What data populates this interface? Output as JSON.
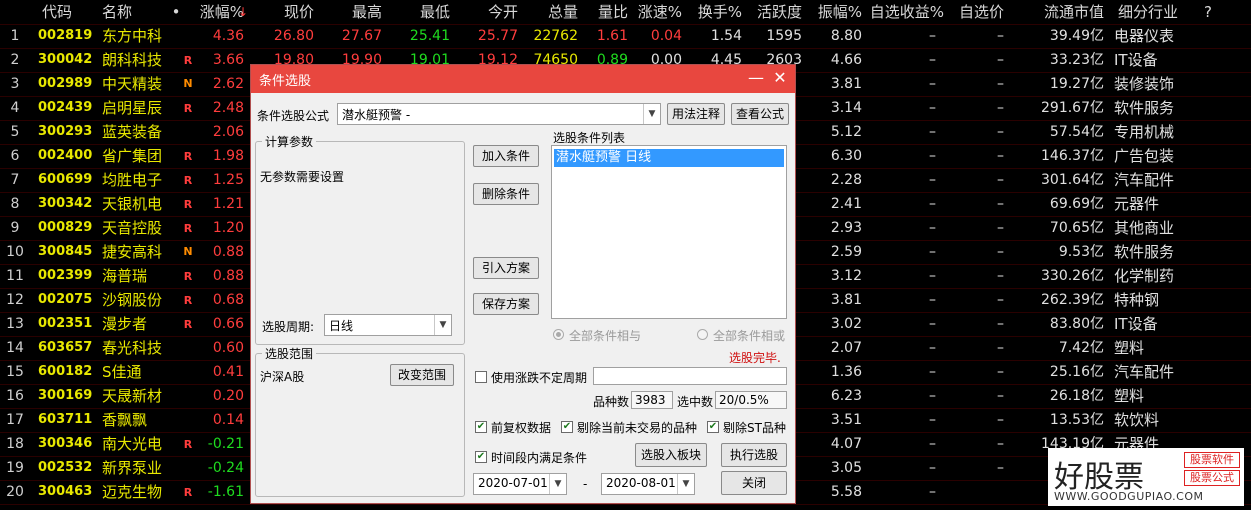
{
  "table": {
    "headers": {
      "idx": "",
      "code": "代码",
      "name": "名称",
      "dot": "•",
      "chg": "涨幅%",
      "price": "现价",
      "high": "最高",
      "low": "最低",
      "open": "今开",
      "vol": "总量",
      "vr": "量比",
      "spd": "涨速%",
      "turn": "换手%",
      "act": "活跃度",
      "amp": "振幅%",
      "ret": "自选收益%",
      "pp": "自选价",
      "cap": "流通市值",
      "ind": "细分行业",
      "q": "?"
    },
    "rows": [
      {
        "idx": "1",
        "code": "002819",
        "name": "东方中科",
        "flag": "",
        "chg": "4.36",
        "price": "26.80",
        "high": "27.67",
        "low": "25.41",
        "open": "25.77",
        "vol": "22762",
        "vr": "1.61",
        "spd": "0.04",
        "turn": "1.54",
        "act": "1595",
        "amp": "8.80",
        "ret": "–",
        "pp": "–",
        "cap": "39.49亿",
        "ind": "电器仪表"
      },
      {
        "idx": "2",
        "code": "300042",
        "name": "朗科科技",
        "flag": "R",
        "chg": "3.66",
        "price": "19.80",
        "high": "19.90",
        "low": "19.01",
        "open": "19.12",
        "vol": "74650",
        "vr": "0.89",
        "spd": "0.00",
        "turn": "4.45",
        "act": "2603",
        "amp": "4.66",
        "ret": "–",
        "pp": "–",
        "cap": "33.23亿",
        "ind": "IT设备"
      },
      {
        "idx": "3",
        "code": "002989",
        "name": "中天精装",
        "flag": "N",
        "chg": "2.62",
        "price": "",
        "high": "",
        "low": "",
        "open": "",
        "vol": "",
        "vr": "",
        "spd": "",
        "turn": "",
        "act": "",
        "amp": "3.81",
        "ret": "–",
        "pp": "–",
        "cap": "19.27亿",
        "ind": "装修装饰"
      },
      {
        "idx": "4",
        "code": "002439",
        "name": "启明星辰",
        "flag": "R",
        "chg": "2.48",
        "price": "",
        "high": "",
        "low": "",
        "open": "",
        "vol": "",
        "vr": "",
        "spd": "",
        "turn": "",
        "act": "",
        "amp": "3.14",
        "ret": "–",
        "pp": "–",
        "cap": "291.67亿",
        "ind": "软件服务"
      },
      {
        "idx": "5",
        "code": "300293",
        "name": "蓝英装备",
        "flag": "",
        "chg": "2.06",
        "price": "",
        "high": "",
        "low": "",
        "open": "",
        "vol": "",
        "vr": "",
        "spd": "",
        "turn": "",
        "act": "",
        "amp": "5.12",
        "ret": "–",
        "pp": "–",
        "cap": "57.54亿",
        "ind": "专用机械"
      },
      {
        "idx": "6",
        "code": "002400",
        "name": "省广集团",
        "flag": "R",
        "chg": "1.98",
        "price": "",
        "high": "",
        "low": "",
        "open": "",
        "vol": "",
        "vr": "",
        "spd": "",
        "turn": "",
        "act": "",
        "amp": "6.30",
        "ret": "–",
        "pp": "–",
        "cap": "146.37亿",
        "ind": "广告包装"
      },
      {
        "idx": "7",
        "code": "600699",
        "name": "均胜电子",
        "flag": "R",
        "chg": "1.25",
        "price": "",
        "high": "",
        "low": "",
        "open": "",
        "vol": "",
        "vr": "",
        "spd": "",
        "turn": "",
        "act": "",
        "amp": "2.28",
        "ret": "–",
        "pp": "–",
        "cap": "301.64亿",
        "ind": "汽车配件"
      },
      {
        "idx": "8",
        "code": "300342",
        "name": "天银机电",
        "flag": "R",
        "chg": "1.21",
        "price": "",
        "high": "",
        "low": "",
        "open": "",
        "vol": "",
        "vr": "",
        "spd": "",
        "turn": "",
        "act": "",
        "amp": "2.41",
        "ret": "–",
        "pp": "–",
        "cap": "69.69亿",
        "ind": "元器件"
      },
      {
        "idx": "9",
        "code": "000829",
        "name": "天音控股",
        "flag": "R",
        "chg": "1.20",
        "price": "",
        "high": "",
        "low": "",
        "open": "",
        "vol": "",
        "vr": "",
        "spd": "",
        "turn": "",
        "act": "",
        "amp": "2.93",
        "ret": "–",
        "pp": "–",
        "cap": "70.65亿",
        "ind": "其他商业"
      },
      {
        "idx": "10",
        "code": "300845",
        "name": "捷安高科",
        "flag": "N",
        "chg": "0.88",
        "price": "",
        "high": "",
        "low": "",
        "open": "",
        "vol": "",
        "vr": "",
        "spd": "",
        "turn": "",
        "act": "",
        "amp": "2.59",
        "ret": "–",
        "pp": "–",
        "cap": "9.53亿",
        "ind": "软件服务"
      },
      {
        "idx": "11",
        "code": "002399",
        "name": "海普瑞",
        "flag": "R",
        "chg": "0.88",
        "price": "",
        "high": "",
        "low": "",
        "open": "",
        "vol": "",
        "vr": "",
        "spd": "",
        "turn": "",
        "act": "",
        "amp": "3.12",
        "ret": "–",
        "pp": "–",
        "cap": "330.26亿",
        "ind": "化学制药"
      },
      {
        "idx": "12",
        "code": "002075",
        "name": "沙钢股份",
        "flag": "R",
        "chg": "0.68",
        "price": "",
        "high": "",
        "low": "",
        "open": "",
        "vol": "",
        "vr": "",
        "spd": "",
        "turn": "",
        "act": "",
        "amp": "3.81",
        "ret": "–",
        "pp": "–",
        "cap": "262.39亿",
        "ind": "特种钢"
      },
      {
        "idx": "13",
        "code": "002351",
        "name": "漫步者",
        "flag": "R",
        "chg": "0.66",
        "price": "",
        "high": "",
        "low": "",
        "open": "",
        "vol": "",
        "vr": "",
        "spd": "",
        "turn": "",
        "act": "",
        "amp": "3.02",
        "ret": "–",
        "pp": "–",
        "cap": "83.80亿",
        "ind": "IT设备"
      },
      {
        "idx": "14",
        "code": "603657",
        "name": "春光科技",
        "flag": "",
        "chg": "0.60",
        "price": "",
        "high": "",
        "low": "",
        "open": "",
        "vol": "",
        "vr": "",
        "spd": "",
        "turn": "",
        "act": "",
        "amp": "2.07",
        "ret": "–",
        "pp": "–",
        "cap": "7.42亿",
        "ind": "塑料"
      },
      {
        "idx": "15",
        "code": "600182",
        "name": "S佳通",
        "flag": "",
        "chg": "0.41",
        "price": "",
        "high": "",
        "low": "",
        "open": "",
        "vol": "",
        "vr": "",
        "spd": "",
        "turn": "",
        "act": "",
        "amp": "1.36",
        "ret": "–",
        "pp": "–",
        "cap": "25.16亿",
        "ind": "汽车配件"
      },
      {
        "idx": "16",
        "code": "300169",
        "name": "天晟新材",
        "flag": "",
        "chg": "0.20",
        "price": "",
        "high": "",
        "low": "",
        "open": "",
        "vol": "",
        "vr": "",
        "spd": "",
        "turn": "",
        "act": "",
        "amp": "6.23",
        "ret": "–",
        "pp": "–",
        "cap": "26.18亿",
        "ind": "塑料"
      },
      {
        "idx": "17",
        "code": "603711",
        "name": "香飘飘",
        "flag": "",
        "chg": "0.14",
        "price": "",
        "high": "",
        "low": "",
        "open": "",
        "vol": "",
        "vr": "",
        "spd": "",
        "turn": "",
        "act": "",
        "amp": "3.51",
        "ret": "–",
        "pp": "–",
        "cap": "13.53亿",
        "ind": "软饮料"
      },
      {
        "idx": "18",
        "code": "300346",
        "name": "南大光电",
        "flag": "R",
        "chg": "-0.21",
        "price": "",
        "high": "",
        "low": "",
        "open": "",
        "vol": "",
        "vr": "",
        "spd": "",
        "turn": "",
        "act": "",
        "amp": "4.07",
        "ret": "–",
        "pp": "–",
        "cap": "143.19亿",
        "ind": "元器件"
      },
      {
        "idx": "19",
        "code": "002532",
        "name": "新界泵业",
        "flag": "",
        "chg": "-0.24",
        "price": "",
        "high": "",
        "low": "",
        "open": "",
        "vol": "",
        "vr": "",
        "spd": "",
        "turn": "",
        "act": "",
        "amp": "3.05",
        "ret": "–",
        "pp": "–",
        "cap": "",
        "ind": ""
      },
      {
        "idx": "20",
        "code": "300463",
        "name": "迈克生物",
        "flag": "R",
        "chg": "-1.61",
        "price": "",
        "high": "",
        "low": "",
        "open": "",
        "vol": "",
        "vr": "",
        "spd": "",
        "turn": "",
        "act": "",
        "amp": "5.58",
        "ret": "–",
        "pp": "",
        "cap": "",
        "ind": ""
      }
    ]
  },
  "colors": {
    "up": "#ff3d3d",
    "down": "#1fdc1f",
    "flag_r": "#ff3d3d",
    "flag_n": "#ff8c00",
    "title_bar": "#e8473f",
    "selection": "#3399ff"
  },
  "dialog": {
    "title": "条件选股",
    "minimize": "—",
    "close": "✕",
    "formula_label": "条件选股公式",
    "formula_value": "潜水艇预警   -",
    "usage_btn": "用法注释",
    "view_btn": "查看公式",
    "calc_group": "计算参数",
    "no_params": "无参数需要设置",
    "period_label": "选股周期:",
    "period_value": "日线",
    "add_btn": "加入条件",
    "delete_btn": "删除条件",
    "import_btn": "引入方案",
    "save_btn": "保存方案",
    "list_label": "选股条件列表",
    "list_items": [
      "潜水艇预警  日线"
    ],
    "radio_and": "全部条件相与",
    "radio_or": "全部条件相或",
    "status": "选股完毕.",
    "scope_group": "选股范围",
    "scope_value": "沪深A股",
    "change_scope_btn": "改变范围",
    "use_uncertain_label": "使用涨跌不定周期",
    "count_label": "品种数",
    "count_value": "3983",
    "hit_label": "选中数",
    "hit_value": "20/0.5%",
    "adj_label": "前复权数据",
    "excl_untraded_label": "剔除当前未交易的品种",
    "excl_st_label": "剔除ST品种",
    "time_range_label": "时间段内满足条件",
    "to_block_btn": "选股入板块",
    "run_btn": "执行选股",
    "date_from": "2020-07-01",
    "date_sep": "-",
    "date_to": "2020-08-01",
    "close_btn": "关闭"
  },
  "watermark": {
    "logo": "好股票",
    "tag1": "股票软件",
    "tag2": "股票公式",
    "url": "WWW.GOODGUPIAO.COM"
  }
}
